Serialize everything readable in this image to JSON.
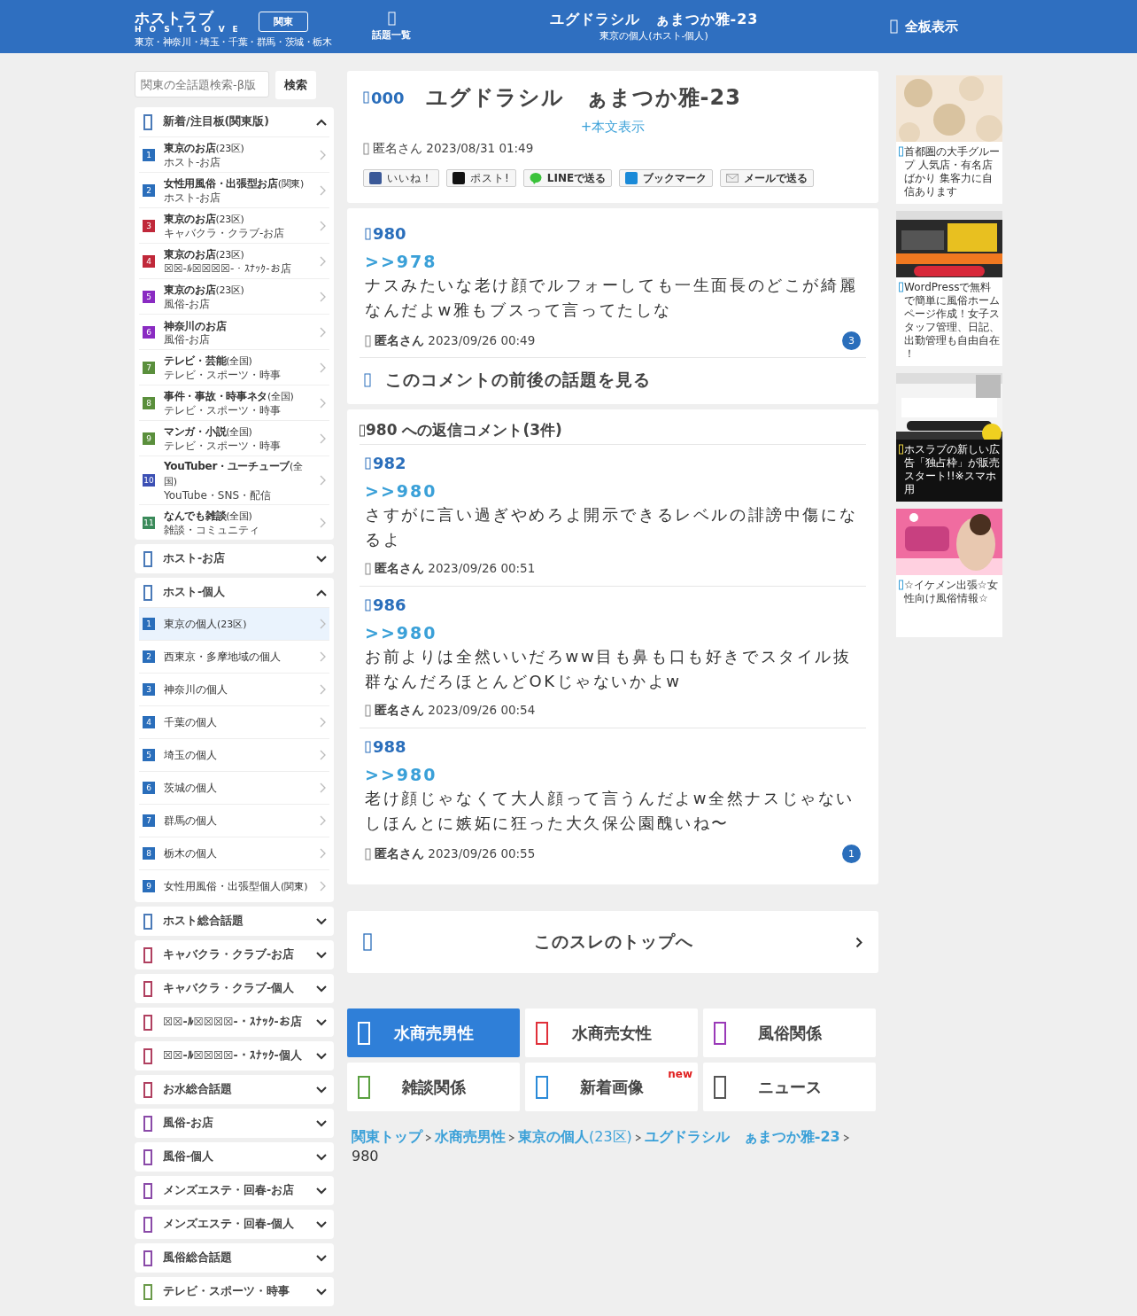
{
  "header": {
    "logo": "ホストラブ",
    "logo_sub": "HOSTLOVE",
    "region_button": "関東",
    "regions": "東京・神奈川・埼玉・千葉・群馬・茨城・栃木",
    "topics_link": "話題一覧",
    "title": "ユグドラシル　ぁまつか雅-23",
    "subtitle": "東京の個人(ホスト-個人)",
    "all_boards": "全板表示"
  },
  "sidebar": {
    "search": {
      "placeholder": "関東の全話題検索-β版",
      "button": "検索"
    },
    "sections": [
      {
        "title": "新着/注目板(関東版)",
        "color": "#4a7ab8",
        "expanded": true,
        "items": [
          {
            "number": "1",
            "color": "#2a6ebb",
            "label": "東京のお店",
            "note": "(23区)",
            "sub": "ホスト-お店",
            "selected": false
          },
          {
            "number": "2",
            "color": "#2a6ebb",
            "label": "女性用風俗・出張型お店",
            "note": "(関東)",
            "sub": "ホスト-お店",
            "selected": false
          },
          {
            "number": "3",
            "color": "#c0283a",
            "label": "東京のお店",
            "note": "(23区)",
            "sub": "キャバクラ・クラブ-お店",
            "selected": false
          },
          {
            "number": "4",
            "color": "#c0283a",
            "label": "東京のお店",
            "note": "(23区)",
            "sub": "☒☒-ﾙ☒☒☒☒-・ｽﾅｯｸ-お店",
            "selected": false
          },
          {
            "number": "5",
            "color": "#8a2bc2",
            "label": "東京のお店",
            "note": "(23区)",
            "sub": "風俗-お店",
            "selected": false
          },
          {
            "number": "6",
            "color": "#8a2bc2",
            "label": "神奈川のお店",
            "sub": "風俗-お店",
            "selected": false
          },
          {
            "number": "7",
            "color": "#5a8f3c",
            "label": "テレビ・芸能",
            "note": "(全国)",
            "sub": "テレビ・スポーツ・時事",
            "selected": false
          },
          {
            "number": "8",
            "color": "#5a8f3c",
            "label": "事件・事故・時事ネタ",
            "note": "(全国)",
            "sub": "テレビ・スポーツ・時事",
            "selected": false
          },
          {
            "number": "9",
            "color": "#5a8f3c",
            "label": "マンガ・小説",
            "note": "(全国)",
            "sub": "テレビ・スポーツ・時事",
            "selected": false
          },
          {
            "number": "10",
            "color": "#3c50b4",
            "label": "YouTuber・ユーチューブ",
            "note": "(全国)",
            "sub": "YouTube・SNS・配信",
            "selected": false
          },
          {
            "number": "11",
            "color": "#3a8a5a",
            "label": "なんでも雑談",
            "note": "(全国)",
            "sub": "雑談・コミュニティ",
            "selected": false
          }
        ]
      },
      {
        "title": "ホスト-お店",
        "color": "#4a7ab8",
        "expanded": false
      },
      {
        "title": "ホスト-個人",
        "color": "#4a7ab8",
        "expanded": true,
        "items": [
          {
            "number": "1",
            "color": "#2a6ebb",
            "label": "東京の個人",
            "note": "(23区)",
            "selected": true
          },
          {
            "number": "2",
            "color": "#2a6ebb",
            "label": "西東京・多摩地域の個人",
            "selected": false
          },
          {
            "number": "3",
            "color": "#2a6ebb",
            "label": "神奈川の個人",
            "selected": false
          },
          {
            "number": "4",
            "color": "#2a6ebb",
            "label": "千葉の個人",
            "selected": false
          },
          {
            "number": "5",
            "color": "#2a6ebb",
            "label": "埼玉の個人",
            "selected": false
          },
          {
            "number": "6",
            "color": "#2a6ebb",
            "label": "茨城の個人",
            "selected": false
          },
          {
            "number": "7",
            "color": "#2a6ebb",
            "label": "群馬の個人",
            "selected": false
          },
          {
            "number": "8",
            "color": "#2a6ebb",
            "label": "栃木の個人",
            "selected": false
          },
          {
            "number": "9",
            "color": "#2a6ebb",
            "label": "女性用風俗・出張型個人",
            "note": "(関東)",
            "selected": false
          }
        ]
      },
      {
        "title": "ホスト総合話題",
        "color": "#4a7ab8",
        "expanded": false
      },
      {
        "title": "キャバクラ・クラブ-お店",
        "color": "#b04060",
        "expanded": false
      },
      {
        "title": "キャバクラ・クラブ-個人",
        "color": "#b04060",
        "expanded": false
      },
      {
        "title": "☒☒-ﾙ☒☒☒☒-・ｽﾅｯｸ-お店",
        "color": "#b04060",
        "expanded": false
      },
      {
        "title": "☒☒-ﾙ☒☒☒☒-・ｽﾅｯｸ-個人",
        "color": "#b04060",
        "expanded": false
      },
      {
        "title": "お水総合話題",
        "color": "#b04060",
        "expanded": false
      },
      {
        "title": "風俗-お店",
        "color": "#8a4aa8",
        "expanded": false
      },
      {
        "title": "風俗-個人",
        "color": "#8a4aa8",
        "expanded": false
      },
      {
        "title": "メンズエステ・回春-お店",
        "color": "#8a4aa8",
        "expanded": false
      },
      {
        "title": "メンズエステ・回春-個人",
        "color": "#8a4aa8",
        "expanded": false
      },
      {
        "title": "風俗総合話題",
        "color": "#8a4aa8",
        "expanded": false
      },
      {
        "title": "テレビ・スポーツ・時事",
        "color": "#6a9a4a",
        "expanded": false
      }
    ]
  },
  "thread": {
    "number": "000",
    "title": "ユグドラシル　ぁまつか雅-23",
    "show_body": "+本文表示",
    "author": "匿名さん",
    "date": "2023/08/31 01:49",
    "share": [
      {
        "kind": "facebook",
        "label": "いいね！"
      },
      {
        "kind": "x",
        "label": "ポスト!"
      },
      {
        "kind": "line",
        "label": "LINEで送る"
      },
      {
        "kind": "hatena",
        "label": "ブックマーク"
      },
      {
        "kind": "mail",
        "label": "メールで送る"
      }
    ]
  },
  "post": {
    "number": "980",
    "anchor": ">>978",
    "body": "ナスみたいな老け顔でルフォーしても一生面長のどこが綺麗なんだよw雅もブスって言ってたしな",
    "author": "匿名さん",
    "date": "2023/09/26 00:49",
    "replies": "3"
  },
  "context_link": "このコメントの前後の話題を見る",
  "reply_section": {
    "title": "980 への返信コメント(3件)",
    "items": [
      {
        "number": "982",
        "anchor": ">>980",
        "body": "さすがに言い過ぎやめろよ開示できるレベルの誹謗中傷になるよ",
        "author": "匿名さん",
        "date": "2023/09/26 00:51"
      },
      {
        "number": "986",
        "anchor": ">>980",
        "body": "お前よりは全然いいだろww目も鼻も口も好きでスタイル抜群なんだろほとんどOKじゃないかよw",
        "author": "匿名さん",
        "date": "2023/09/26 00:54"
      },
      {
        "number": "988",
        "anchor": ">>980",
        "body": "老け顔じゃなくて大人顔って言うんだよw全然ナスじゃないしほんとに嫉妬に狂った大久保公園醜いね〜",
        "author": "匿名さん",
        "date": "2023/09/26 00:55",
        "replies": "1"
      }
    ]
  },
  "top_link": "このスレのトップへ",
  "categories": [
    {
      "label": "水商売男性",
      "color": "#2f7fd8",
      "selected": true
    },
    {
      "label": "水商売女性",
      "color": "#e0303a",
      "selected": false
    },
    {
      "label": "風俗関係",
      "color": "#9a3ab8",
      "selected": false
    },
    {
      "label": "雑談関係",
      "color": "#5aa040",
      "selected": false
    },
    {
      "label": "新着画像",
      "color": "#2a8ad8",
      "selected": false,
      "badge": "new"
    },
    {
      "label": "ニュース",
      "color": "#555555",
      "selected": false
    }
  ],
  "breadcrumb": [
    {
      "label": "関東トップ"
    },
    {
      "label": "水商売男性"
    },
    {
      "label": "東京の個人",
      "note": "(23区)"
    },
    {
      "label": "ユグドラシル　ぁまつか雅-23"
    }
  ],
  "breadcrumb_current": "980",
  "ads": [
    {
      "caption": "首都圏の大手グループ 人気店・有名店ばかり 集客力に自信あります",
      "dark": false
    },
    {
      "caption": "WordPressで無料で簡単に風俗ホームページ作成！女子スタッフ管理、日記、出勤管理も自由自在！",
      "dark": false
    },
    {
      "caption": "ホスラブの新しい広告「独占枠」が販売スタート!!※スマホ用",
      "dark": true
    },
    {
      "caption": "☆イケメン出張☆女性向け風俗情報☆",
      "dark": false
    }
  ]
}
